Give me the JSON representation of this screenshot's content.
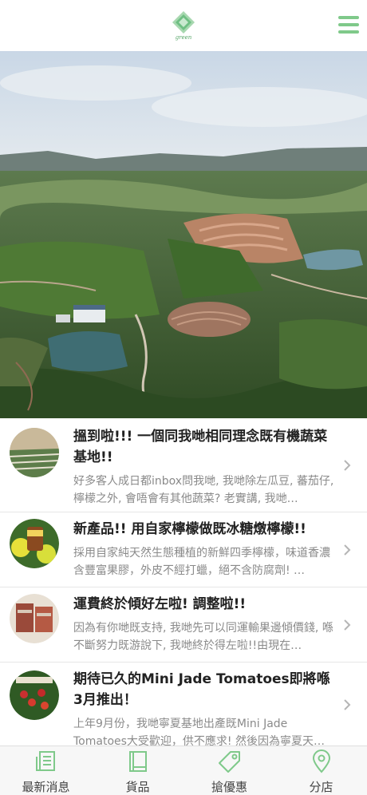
{
  "header": {
    "logo_icon": "green-diamond-logo",
    "menu_icon": "hamburger-menu-icon",
    "accent_color": "#7fc98a"
  },
  "hero": {
    "image": "aerial-farm-landscape"
  },
  "news": [
    {
      "title": "搵到啦!!! 一個同我哋相同理念既有機蔬菜基地!!",
      "desc": "好多客人成日都inbox問我哋, 我哋除左瓜豆, 蕃茄仔, 檸檬之外, 會唔會有其他蔬菜? 老實講, 我哋…"
    },
    {
      "title": "新產品!! 用自家檸檬做既冰糖燉檸檬!!",
      "desc": "採用自家純天然生態種植的新鮮四季檸檬，味道香濃含豐富果膠，外皮不經打蠟，絕不含防腐劑! …"
    },
    {
      "title": "運費終於傾好左啦! 調整啦!!",
      "desc": "因為有你哋既支持, 我哋先可以同運輸果邊傾價錢, 喺不斷努力既游說下, 我哋終於得左啦!!由現在…"
    },
    {
      "title": "期待已久的Mini Jade Tomatoes即將喺3月推出！",
      "desc": "上年9月份，我哋寧夏基地出產既Mini Jade Tomatoes大受歡迎，供不應求! 然後因為寧夏天…"
    }
  ],
  "tabs": [
    {
      "label": "最新消息",
      "icon": "newspaper-icon"
    },
    {
      "label": "貨品",
      "icon": "book-icon"
    },
    {
      "label": "搶優惠",
      "icon": "tag-icon"
    },
    {
      "label": "分店",
      "icon": "location-pin-icon"
    }
  ]
}
